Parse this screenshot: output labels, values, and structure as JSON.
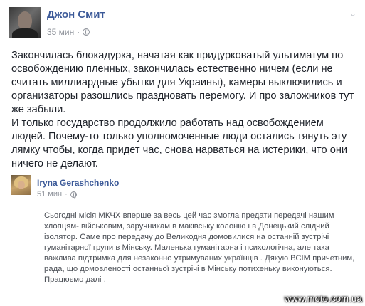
{
  "post": {
    "author": "Джон Смит",
    "time": "35 мин",
    "dot": "·",
    "paragraphs": [
      "Закончилась блокадурка, начатая как придурковатый ультиматум по освобождению пленных, закончилась естественно ничем (если не считать миллиардные убытки для Украины), камеры выключились и организаторы разошлись праздновать перемогу. И про заложников тут же забыли.",
      "И только государство продолжило работать над освобождением людей. Почему-то только уполномоченные люди остались тянуть эту лямку чтобы, когда придет час, снова нарваться на истерики, что они ничего не делают."
    ],
    "menu_icon": "chevron-down-icon"
  },
  "shared": {
    "author": "Iryna Gerashchenko",
    "time": "51 мин",
    "dot": "·",
    "text": "Сьогодні місія МКЧХ вперше за весь цей час змогла предати передачі нашим хлопцям- військовим, заручникам в маківську колонію і в Донецький слідчий ізолятор. Саме про передачу до Великодня домовилися на останній зустрічі гуманітарної групи в Мінську. Маленька гуманітарна і психологічна, але така важлива підтримка для незаконно утримуваних українців . Дякую ВСІМ причетним, рада, що домовленості останньої зустрічі в Мінську потихеньку виконуються. Працюємо далі ."
  },
  "watermark": "www.moto.com.ua",
  "colors": {
    "name_link": "#3b5998",
    "meta_gray": "#90949c",
    "text": "#1d2129"
  }
}
